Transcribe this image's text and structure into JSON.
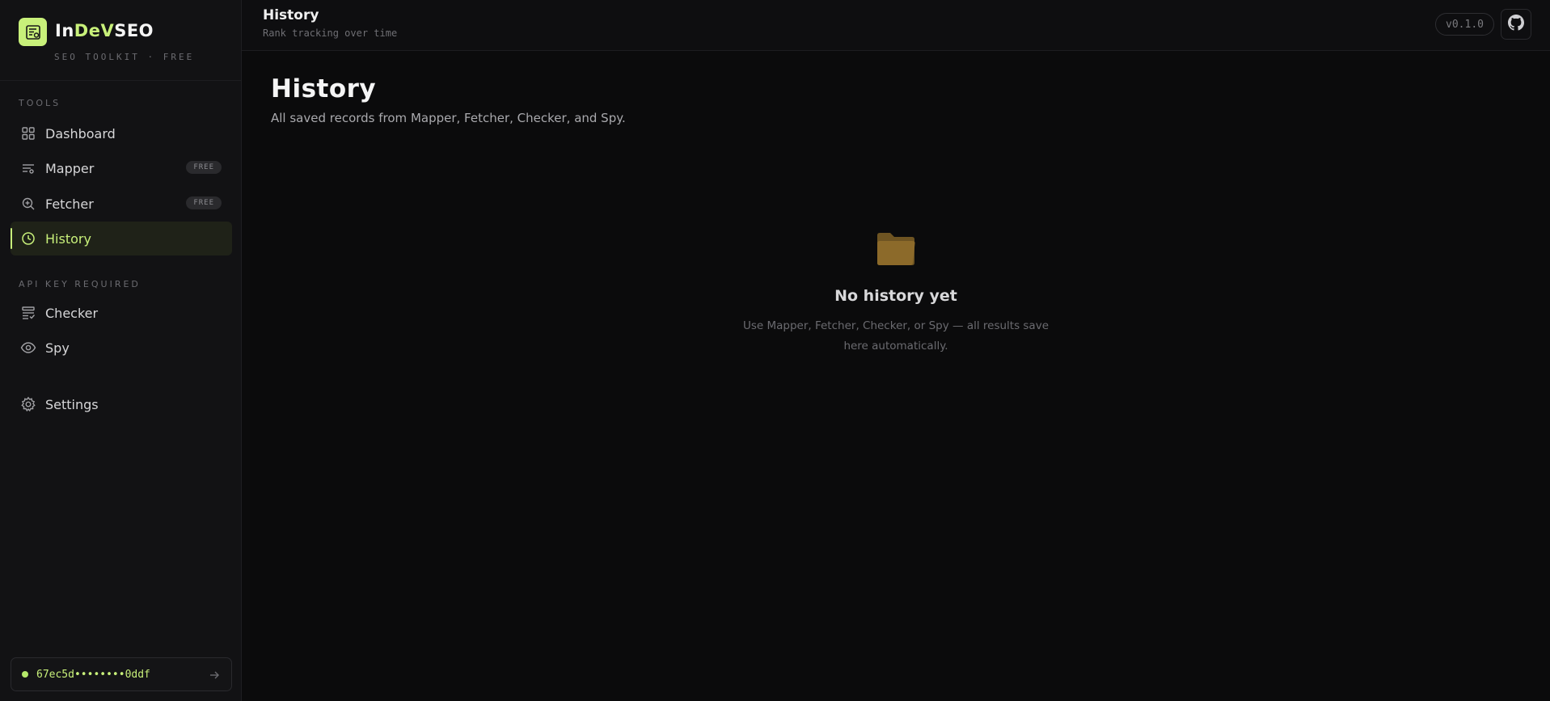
{
  "brand": {
    "name_prefix": "In",
    "name_accent": "DeV",
    "name_suffix": "SEO",
    "tagline": "SEO TOOLKIT · FREE"
  },
  "sidebar": {
    "sections": {
      "tools": "TOOLS",
      "api": "API KEY REQUIRED"
    },
    "items": [
      {
        "label": "Dashboard",
        "icon": "grid-icon"
      },
      {
        "label": "Mapper",
        "icon": "list-filter-icon",
        "badge": "FREE"
      },
      {
        "label": "Fetcher",
        "icon": "zoom-icon",
        "badge": "FREE"
      },
      {
        "label": "History",
        "icon": "clock-icon",
        "active": true
      },
      {
        "label": "Checker",
        "icon": "list-check-icon"
      },
      {
        "label": "Spy",
        "icon": "eye-icon"
      },
      {
        "label": "Settings",
        "icon": "gear-icon"
      }
    ],
    "api_key": "67ec5d••••••••0ddf"
  },
  "topbar": {
    "title": "History",
    "subtitle": "Rank tracking over time",
    "version": "v0.1.0"
  },
  "main": {
    "title": "History",
    "subtitle": "All saved records from Mapper, Fetcher, Checker, and Spy.",
    "empty_title": "No history yet",
    "empty_desc": "Use Mapper, Fetcher, Checker, or Spy — all results save here automatically."
  },
  "colors": {
    "accent": "#c8f07a",
    "folder": "#8c6a2a",
    "background": "#0b0b0c"
  }
}
